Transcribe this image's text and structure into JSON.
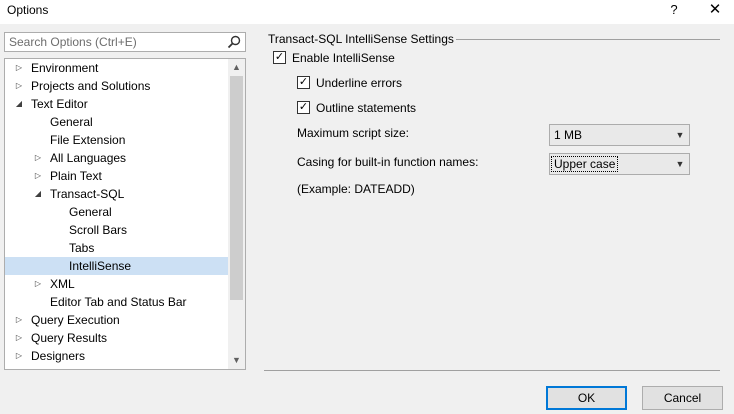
{
  "window": {
    "title": "Options",
    "help_glyph": "?",
    "close_glyph": "✕"
  },
  "search": {
    "placeholder": "Search Options (Ctrl+E)"
  },
  "tree": {
    "items": [
      {
        "label": "Environment",
        "arrow": "▷"
      },
      {
        "label": "Projects and Solutions",
        "arrow": "▷"
      },
      {
        "label": "Text Editor",
        "arrow": "◢"
      },
      {
        "label": "General",
        "arrow": ""
      },
      {
        "label": "File Extension",
        "arrow": ""
      },
      {
        "label": "All Languages",
        "arrow": "▷"
      },
      {
        "label": "Plain Text",
        "arrow": "▷"
      },
      {
        "label": "Transact-SQL",
        "arrow": "◢"
      },
      {
        "label": "General",
        "arrow": ""
      },
      {
        "label": "Scroll Bars",
        "arrow": ""
      },
      {
        "label": "Tabs",
        "arrow": ""
      },
      {
        "label": "IntelliSense",
        "arrow": ""
      },
      {
        "label": "XML",
        "arrow": "▷"
      },
      {
        "label": "Editor Tab and Status Bar",
        "arrow": ""
      },
      {
        "label": "Query Execution",
        "arrow": "▷"
      },
      {
        "label": "Query Results",
        "arrow": "▷"
      },
      {
        "label": "Designers",
        "arrow": "▷"
      }
    ],
    "selected": "IntelliSense"
  },
  "settings": {
    "section_title": "Transact-SQL IntelliSense Settings",
    "enable_intellisense": {
      "label": "Enable IntelliSense",
      "checked": true,
      "mark": "✓"
    },
    "underline_errors": {
      "label": "Underline errors",
      "checked": true,
      "mark": "✓"
    },
    "outline_statements": {
      "label": "Outline statements",
      "checked": true,
      "mark": "✓"
    },
    "max_script_size": {
      "label": "Maximum script size:",
      "value": "1 MB"
    },
    "casing": {
      "label": "Casing for built-in function names:",
      "value": "Upper case"
    },
    "example": "(Example: DATEADD)"
  },
  "buttons": {
    "ok": "OK",
    "cancel": "Cancel"
  },
  "colors": {
    "selection": "#cce0f4",
    "default_button_border": "#0078d7",
    "dialog_bg": "#f0f0f0"
  }
}
